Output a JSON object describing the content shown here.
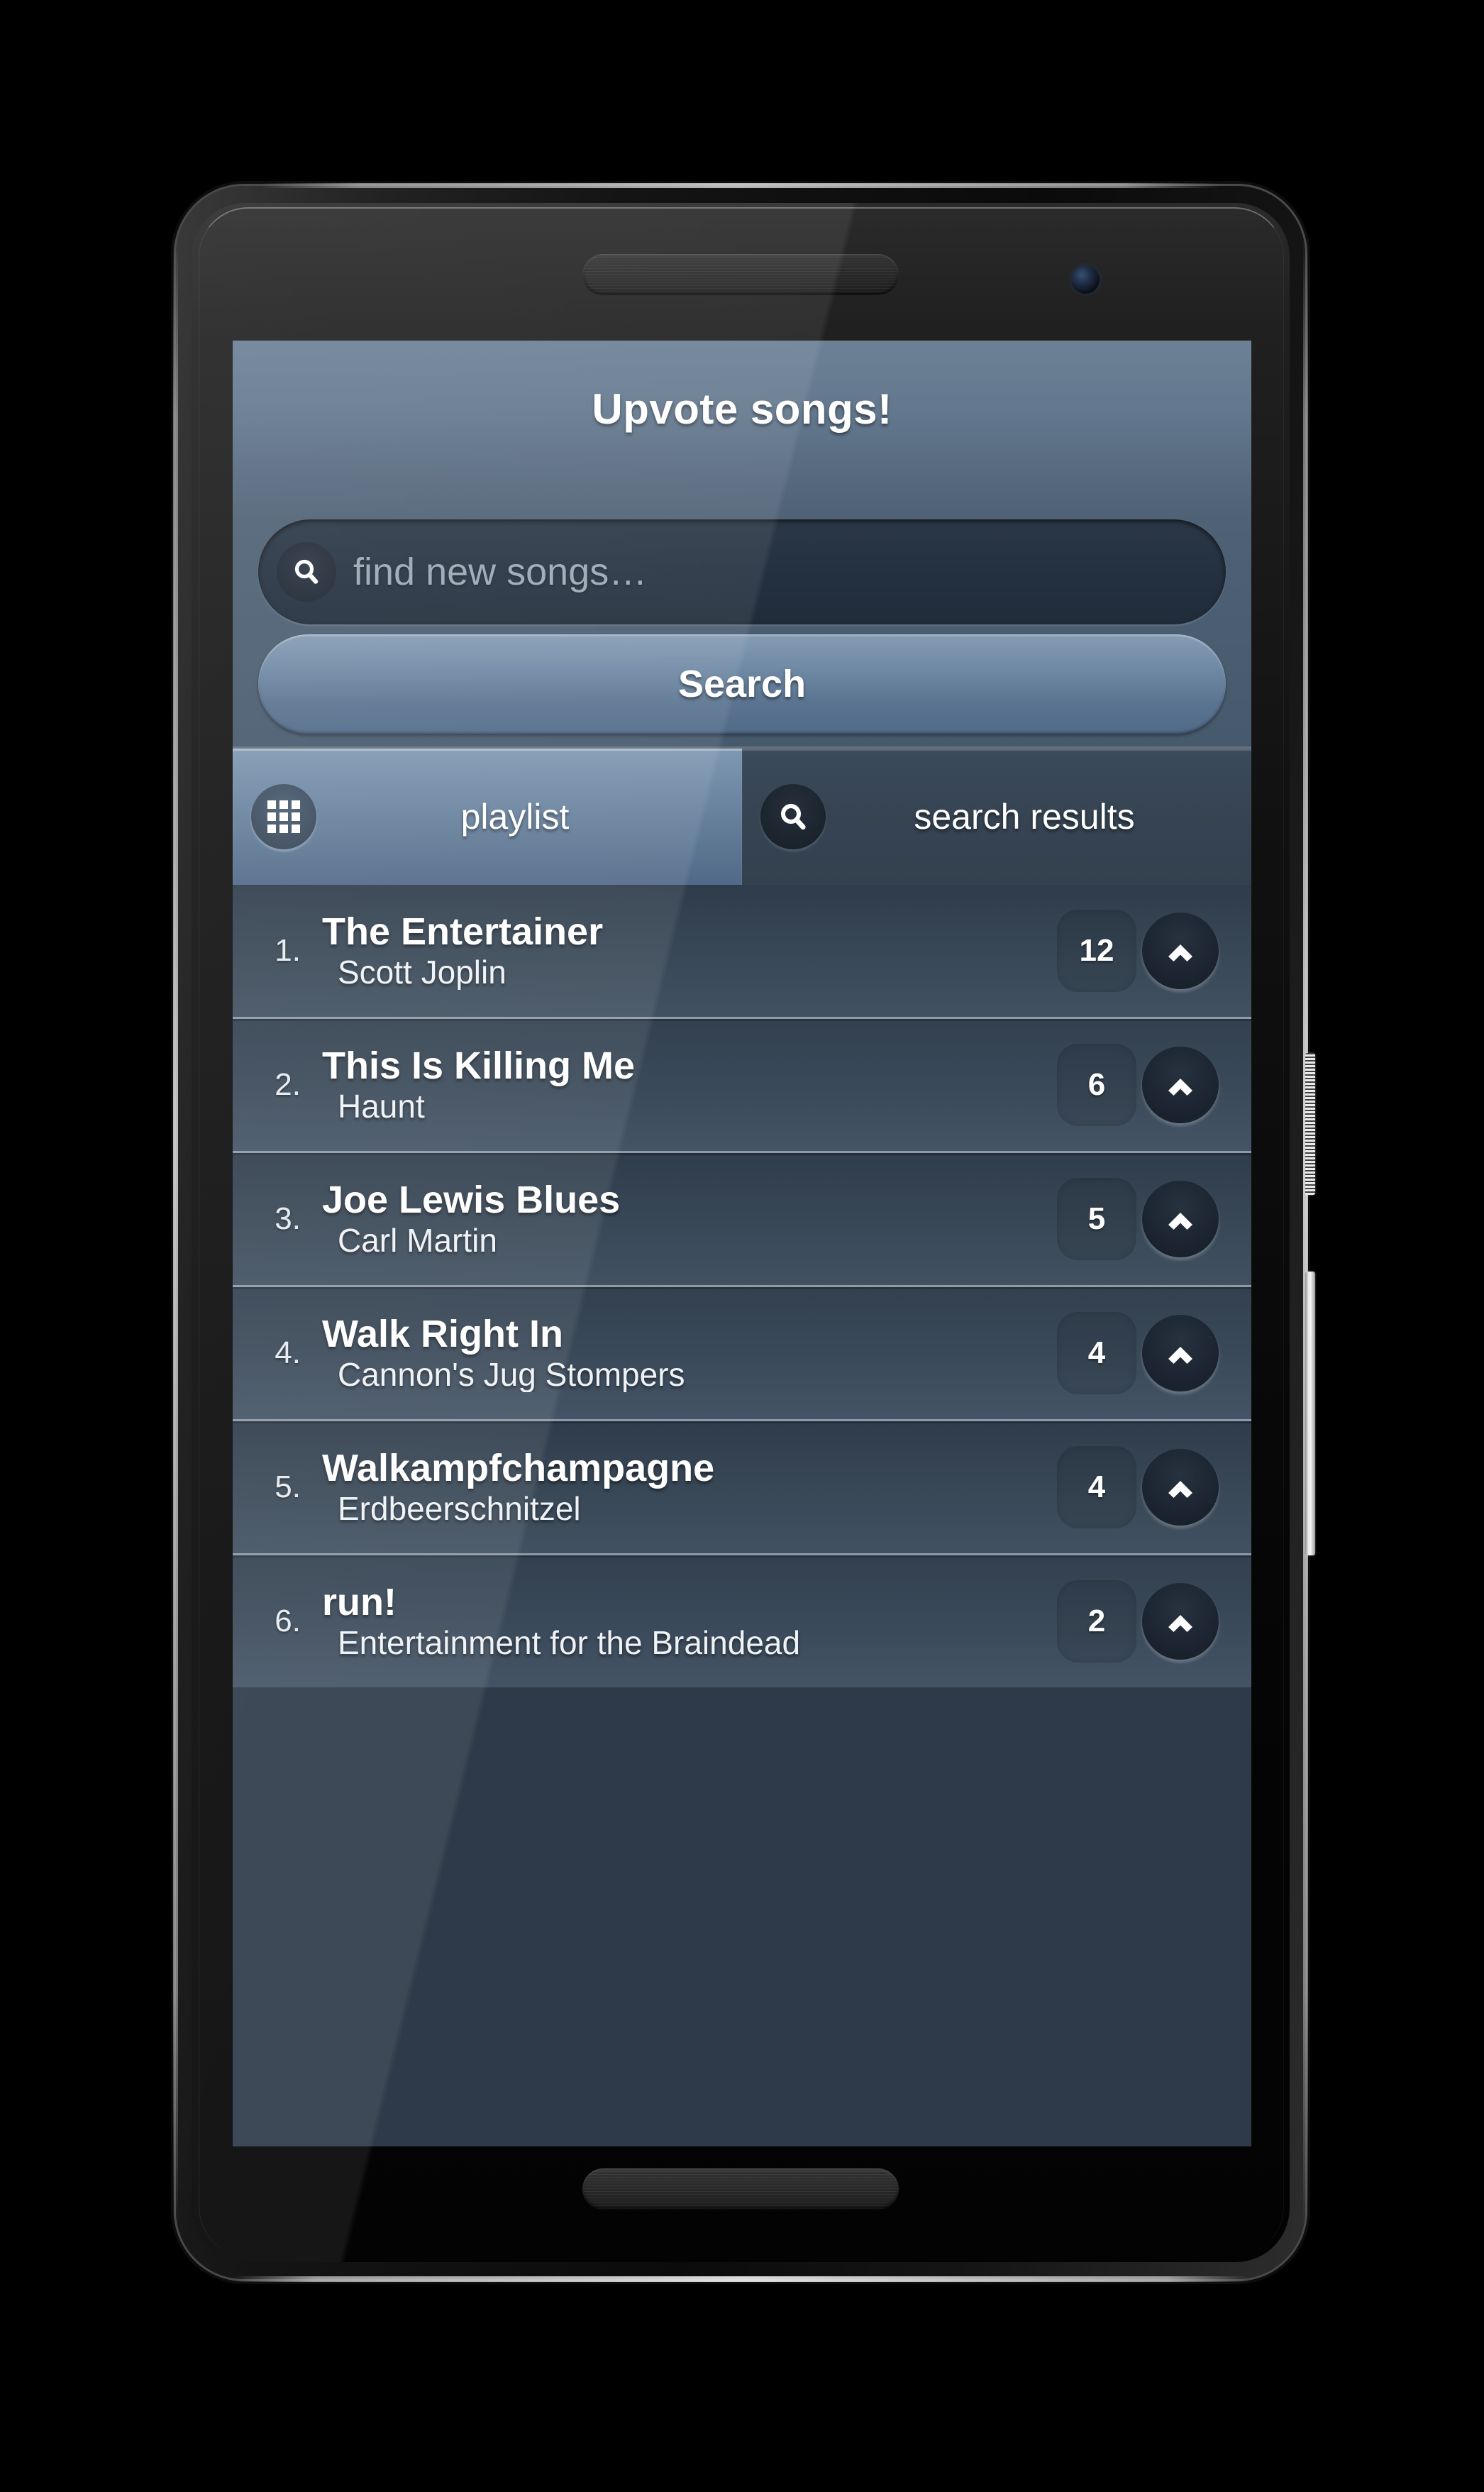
{
  "app": {
    "title": "Upvote songs!"
  },
  "search": {
    "placeholder": "find new songs…",
    "value": "",
    "icon": "search-icon",
    "button_label": "Search"
  },
  "tabs": [
    {
      "label": "playlist",
      "icon": "grid-icon",
      "active": true
    },
    {
      "label": "search results",
      "icon": "search-icon",
      "active": false
    }
  ],
  "playlist": {
    "columns": [
      "rank",
      "title",
      "artist",
      "votes"
    ],
    "songs": [
      {
        "rank": "1.",
        "title": "The Entertainer",
        "artist": "Scott Joplin",
        "votes": "12"
      },
      {
        "rank": "2.",
        "title": "This Is Killing Me",
        "artist": "Haunt",
        "votes": "6"
      },
      {
        "rank": "3.",
        "title": "Joe Lewis Blues",
        "artist": "Carl Martin",
        "votes": "5"
      },
      {
        "rank": "4.",
        "title": "Walk Right In",
        "artist": "Cannon's Jug Stompers",
        "votes": "4"
      },
      {
        "rank": "5.",
        "title": "Walkampfchampagne",
        "artist": "Erdbeerschnitzel",
        "votes": "4"
      },
      {
        "rank": "6.",
        "title": "run!",
        "artist": "Entertainment for the Braindead",
        "votes": "2"
      }
    ],
    "upvote_icon": "chevron-up-icon"
  },
  "device": {
    "speaker_top": "speaker-grille-icon",
    "speaker_bottom": "speaker-grille-icon",
    "camera": "front-camera-icon",
    "power_button": "power-button",
    "volume_button": "volume-rocker-button"
  },
  "colors": {
    "header": "#62778d",
    "accent": "#708aa5",
    "screen_bg": "#2e3a49",
    "tab_active": "#6b85a0",
    "tab_inactive": "#364453",
    "text": "#ffffff"
  }
}
